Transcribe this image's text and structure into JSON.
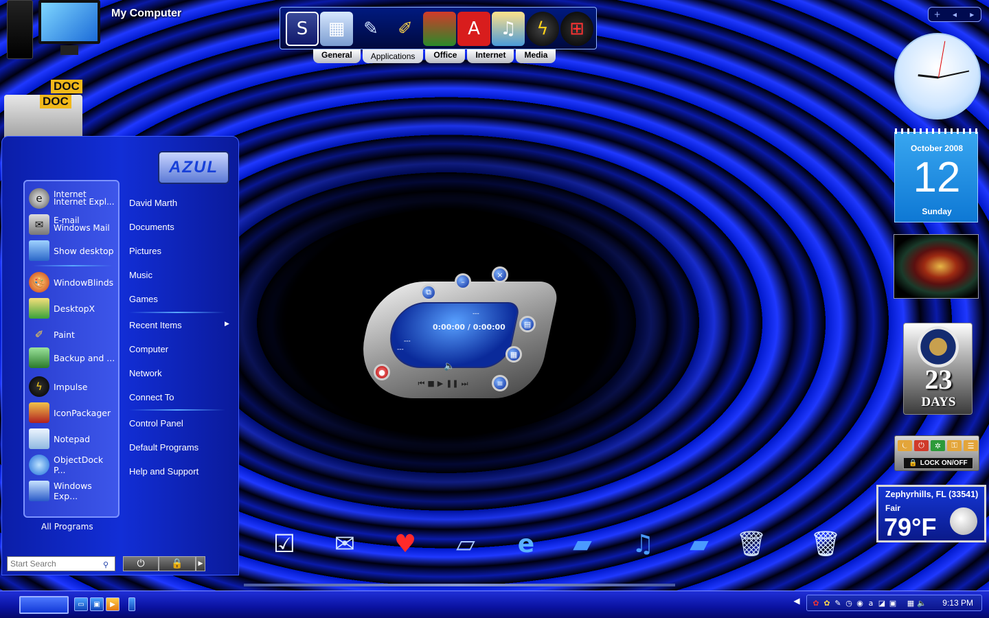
{
  "desktop": {
    "my_computer_label": "My Computer",
    "doc_tag_1": "DOC",
    "doc_tag_2": "DOC"
  },
  "top_dock": {
    "icons": [
      "stardock-icon",
      "calculator-icon",
      "tools-icon",
      "paint-icon",
      "books-icon",
      "acrobat-icon",
      "media-icon",
      "impulse-icon",
      "windows-icon"
    ],
    "tabs": [
      "General",
      "Applications",
      "Office",
      "Internet",
      "Media"
    ],
    "active_tab": "Applications"
  },
  "pager": {
    "add": "+",
    "prev": "◂",
    "next": "▸"
  },
  "start_menu": {
    "logo": "AZUL",
    "left_items": [
      {
        "name": "internet-explorer",
        "line1": "Internet",
        "line2": "Internet Expl..."
      },
      {
        "name": "windows-mail",
        "line1": "E-mail",
        "line2": "Windows Mail"
      },
      {
        "name": "show-desktop",
        "label": "Show desktop"
      },
      {
        "name": "windowblinds",
        "label": "WindowBlinds"
      },
      {
        "name": "desktopx",
        "label": "DesktopX"
      },
      {
        "name": "paint",
        "label": "Paint"
      },
      {
        "name": "backup",
        "label": "Backup and ..."
      },
      {
        "name": "impulse",
        "label": "Impulse"
      },
      {
        "name": "iconpackager",
        "label": "IconPackager"
      },
      {
        "name": "notepad",
        "label": "Notepad"
      },
      {
        "name": "objectdock",
        "label": "ObjectDock P..."
      },
      {
        "name": "windows-explorer",
        "label": "Windows Exp..."
      }
    ],
    "all_programs": "All Programs",
    "right_items": [
      "David Marth",
      "Documents",
      "Pictures",
      "Music",
      "Games",
      "Recent Items",
      "Computer",
      "Network",
      "Connect To",
      "Control Panel",
      "Default Programs",
      "Help and Support"
    ],
    "search_placeholder": "Start Search",
    "submenu_arrow": "▶",
    "power_icon": "⏻",
    "lock_icon": "🔒",
    "more_icon": "▶"
  },
  "media_player": {
    "time": "0:00:00 / 0:00:00",
    "dash_1": "---",
    "dash_2": "---",
    "dash_3": "---"
  },
  "clock": {
    "hour": 9,
    "minute": 13
  },
  "calendar": {
    "month": "October 2008",
    "day": "12",
    "weekday": "Sunday"
  },
  "countdown": {
    "number": "23",
    "label": "DAYS"
  },
  "lock_gadget": {
    "label": "LOCK ON/OFF"
  },
  "weather": {
    "location": "Zephyrhills, FL (33541)",
    "condition": "Fair",
    "temperature": "79°F"
  },
  "bottom_dock": {
    "icons": [
      "tasks-icon",
      "mail-icon",
      "favorites-folder-icon",
      "scanner-icon",
      "internet-explorer-icon",
      "open-folder-icon",
      "music-folder-icon",
      "documents-folder-icon",
      "recycle-bin-empty-icon",
      "recycle-bin-full-icon"
    ]
  },
  "taskbar": {
    "time": "9:13 PM",
    "tray_arrow": "◀"
  },
  "colors": {
    "accent": "#1f38ff",
    "taskbar": "#0a12a0",
    "calendar": "#0e78d4"
  }
}
